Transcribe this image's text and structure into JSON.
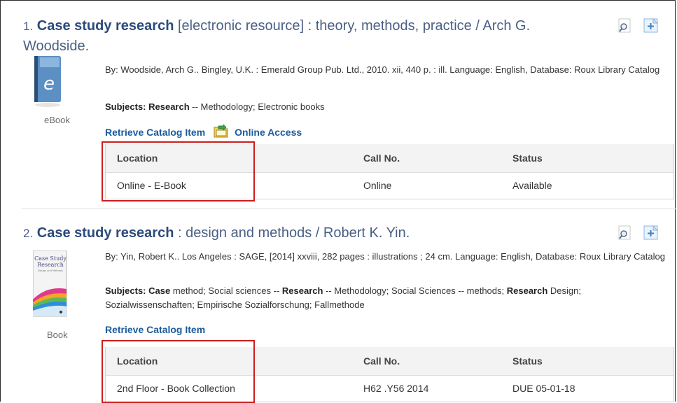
{
  "results": [
    {
      "number": "1.",
      "title_bold": "Case study research",
      "title_rest": " [electronic resource] : theory, methods, practice / Arch G. Woodside.",
      "type_label": "eBook",
      "byline": "By: Woodside, Arch G.. Bingley, U.K. : Emerald Group Pub. Ltd., 2010. xii, 440 p. : ill. Language: English, Database: Roux Library Catalog",
      "subjects_label": "Subjects:",
      "subjects_rich": [
        {
          "text": " Research",
          "bold": true
        },
        {
          "text": " -- Methodology; Electronic books",
          "bold": false
        }
      ],
      "retrieve_link": "Retrieve Catalog Item",
      "online_access_link": "Online Access",
      "holdings_headers": {
        "location": "Location",
        "call_no": "Call No.",
        "status": "Status"
      },
      "holdings_rows": [
        {
          "location": "Online - E-Book",
          "call_no": "Online",
          "status": "Available"
        }
      ]
    },
    {
      "number": "2.",
      "title_bold": "Case study research",
      "title_rest": " : design and methods / Robert K. Yin.",
      "type_label": "Book",
      "cover_text": {
        "line1": "Case Study",
        "line2": "Research",
        "line3": "Design and Methods"
      },
      "byline": "By: Yin, Robert K.. Los Angeles : SAGE, [2014] xxviii, 282 pages : illustrations ; 24 cm. Language: English, Database: Roux Library Catalog",
      "subjects_label": "Subjects:",
      "subjects_rich": [
        {
          "text": " Case",
          "bold": true
        },
        {
          "text": " method; Social sciences -- ",
          "bold": false
        },
        {
          "text": "Research",
          "bold": true
        },
        {
          "text": " -- Methodology; Social Sciences -- methods; ",
          "bold": false
        },
        {
          "text": "Research",
          "bold": true
        },
        {
          "text": " Design; Sozialwissenschaften; Empirische Sozialforschung; Fallmethode",
          "bold": false
        }
      ],
      "retrieve_link": "Retrieve Catalog Item",
      "holdings_headers": {
        "location": "Location",
        "call_no": "Call No.",
        "status": "Status"
      },
      "holdings_rows": [
        {
          "location": "2nd Floor - Book Collection",
          "call_no": "H62 .Y56 2014",
          "status": "DUE 05-01-18"
        }
      ]
    }
  ],
  "icons": {
    "preview": "magnifier-preview-icon",
    "add_folder": "add-to-folder-icon",
    "online_access": "online-access-folder-icon",
    "ebook": "ebook-icon"
  },
  "colors": {
    "title": "#2c4b7c",
    "link": "#1b5b9c",
    "highlight_box": "#cc1d1d"
  }
}
